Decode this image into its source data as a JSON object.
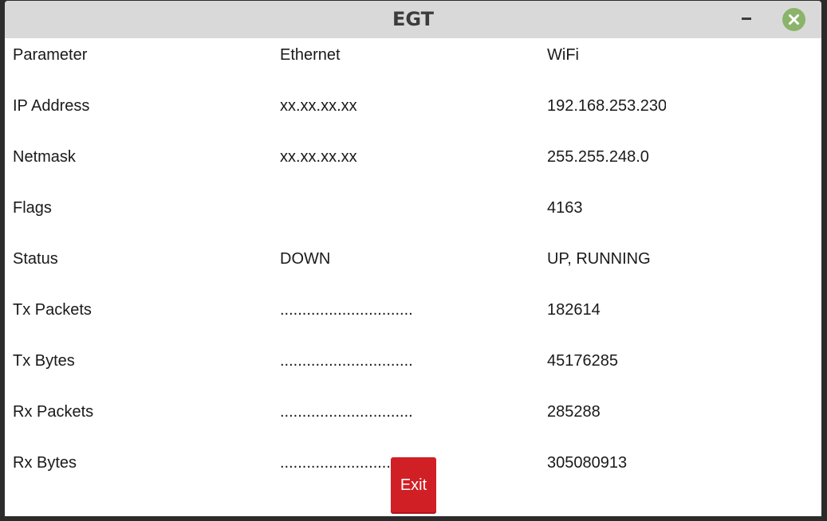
{
  "window": {
    "title": "EGT"
  },
  "table": {
    "headers": [
      "Parameter",
      "Ethernet",
      "WiFi"
    ],
    "rows": [
      [
        "IP Address",
        "xx.xx.xx.xx",
        "192.168.253.230"
      ],
      [
        "Netmask",
        "xx.xx.xx.xx",
        "255.255.248.0"
      ],
      [
        "Flags",
        "",
        "4163"
      ],
      [
        "Status",
        "DOWN",
        "UP, RUNNING"
      ],
      [
        "Tx Packets",
        "..............................",
        "182614"
      ],
      [
        "Tx Bytes",
        "..............................",
        "45176285"
      ],
      [
        "Rx Packets",
        "..............................",
        "285288"
      ],
      [
        "Rx Bytes",
        "..............................",
        "305080913"
      ]
    ]
  },
  "buttons": {
    "exit_label": "Exit"
  },
  "icons": {
    "minimize": "minimize-icon",
    "close": "close-icon"
  },
  "colors": {
    "titlebar": "#d9d9d9",
    "close_button": "#8ab46a",
    "exit_button": "#d11f26"
  }
}
